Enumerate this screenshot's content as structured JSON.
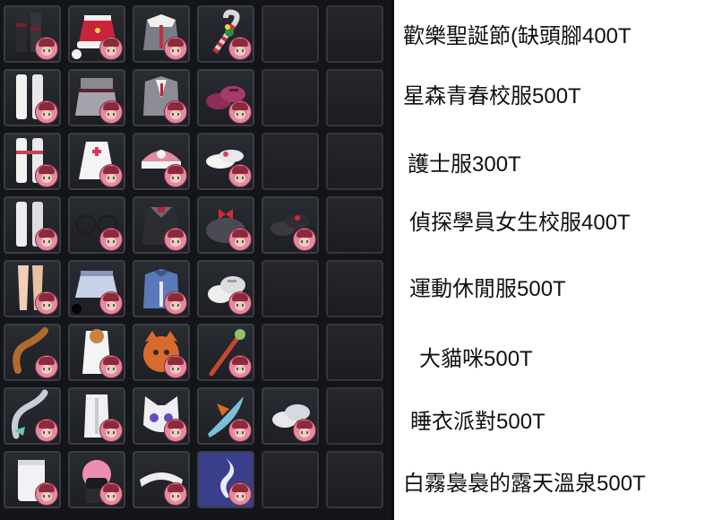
{
  "sets": [
    {
      "label": "歡樂聖誕節(缺頭腳400T",
      "items": [
        "leg-warmers-icon",
        "santa-skirt-icon",
        "fur-coat-icon",
        "candy-cane-icon"
      ],
      "dots": {
        "1": "light"
      }
    },
    {
      "label": "星森青春校服500T",
      "items": [
        "white-stockings-icon",
        "school-skirt-icon",
        "school-blazer-icon",
        "mary-jane-shoes-icon"
      ],
      "dots": {}
    },
    {
      "label": "護士服300T",
      "items": [
        "nurse-stockings-icon",
        "nurse-dress-icon",
        "nurse-cap-icon",
        "nurse-shoes-icon"
      ],
      "dots": {}
    },
    {
      "label": "偵探學員女生校服400T",
      "items": [
        "knee-socks-icon",
        "round-glasses-icon",
        "detective-cape-icon",
        "bow-beret-icon",
        "bow-shoes-icon"
      ],
      "dots": {}
    },
    {
      "label": "運動休閒服500T",
      "items": [
        "bare-legs-icon",
        "pleated-skirt-icon",
        "hoodie-icon",
        "sneakers-icon"
      ],
      "dots": {
        "1": "dark"
      }
    },
    {
      "label": "大貓咪500T",
      "items": [
        "cat-tail-icon",
        "cat-onesie-icon",
        "cat-mask-icon",
        "cat-wand-icon"
      ],
      "dots": {}
    },
    {
      "label": "睡衣派對500T",
      "items": [
        "sleepy-tail-icon",
        "pajama-icon",
        "cat-hood-icon",
        "fire-blade-icon",
        "bunny-slippers-icon"
      ],
      "dots": {}
    },
    {
      "label": "白霧裊裊的露天溫泉500T",
      "items": [
        "bath-towel-icon",
        "pink-hair-mask-icon",
        "towel-headband-icon",
        "steam-effect-icon"
      ],
      "dots": {}
    }
  ]
}
